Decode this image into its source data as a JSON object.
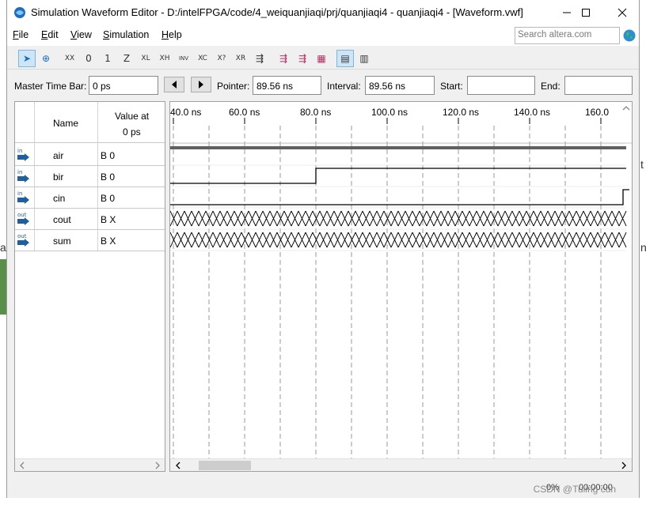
{
  "window": {
    "title": "Simulation Waveform Editor - D:/intelFPGA/code/4_weiquanjiaqi/prj/quanjiaqi4 - quanjiaqi4 - [Waveform.vwf]"
  },
  "menu": {
    "items": [
      {
        "label": "File",
        "underline": "F",
        "rest": "ile"
      },
      {
        "label": "Edit",
        "underline": "E",
        "rest": "dit"
      },
      {
        "label": "View",
        "underline": "V",
        "rest": "iew"
      },
      {
        "label": "Simulation",
        "underline": "S",
        "rest": "imulation"
      },
      {
        "label": "Help",
        "underline": "H",
        "rest": "elp"
      }
    ]
  },
  "search": {
    "placeholder": "Search altera.com"
  },
  "toolbar": {
    "icons": [
      "selection-tool-icon",
      "zoom-tool-icon",
      "undefined-value-icon",
      "force-low-icon",
      "force-high-icon",
      "high-impedance-icon",
      "weak-low-icon",
      "weak-high-icon",
      "invert-icon",
      "count-value-icon",
      "clock-icon",
      "arbitrary-value-icon",
      "random-value-icon",
      "run-functional-simulation-icon",
      "run-timing-simulation-icon",
      "generate-netlist-icon",
      "snap-to-grid-icon",
      "sort-icon"
    ],
    "glyphs": [
      "➤",
      "⊕",
      "XX",
      "0",
      "1",
      "Z",
      "XL",
      "XH",
      "INV",
      "XC",
      "X?",
      "XR",
      "⇶",
      "⇶",
      "⇶",
      "▦",
      "▤",
      "▥"
    ],
    "sub_labels": [
      "",
      "",
      "",
      "",
      "",
      "",
      "L",
      "H",
      "",
      "C",
      "?",
      "R",
      "",
      "",
      "",
      "",
      "",
      ""
    ]
  },
  "timebar": {
    "master_label": "Master Time Bar:",
    "master_value": "0 ps",
    "pointer_label": "Pointer:",
    "pointer_value": "89.56 ns",
    "interval_label": "Interval:",
    "interval_value": "89.56 ns",
    "start_label": "Start:",
    "start_value": "",
    "end_label": "End:",
    "end_value": ""
  },
  "signals": {
    "header_name": "Name",
    "header_value_line1": "Value at",
    "header_value_line2": "0 ps",
    "rows": [
      {
        "dir": "in",
        "name": "air",
        "value": "B 0",
        "wave": "low"
      },
      {
        "dir": "in",
        "name": "bir",
        "value": "B 0",
        "wave": "rise-80"
      },
      {
        "dir": "in",
        "name": "cin",
        "value": "B 0",
        "wave": "rise-end"
      },
      {
        "dir": "out",
        "name": "cout",
        "value": "B X",
        "wave": "x"
      },
      {
        "dir": "out",
        "name": "sum",
        "value": "B X",
        "wave": "x"
      }
    ]
  },
  "timeline": {
    "ticks": [
      "40.0 ns",
      "60.0 ns",
      "80.0 ns",
      "100.0 ns",
      "120.0 ns",
      "140.0 ns",
      "160.0"
    ],
    "tick_values_ns": [
      40,
      60,
      80,
      100,
      120,
      140,
      160
    ]
  },
  "status": {
    "percent": "0%",
    "time": "00:00:00",
    "watermark": "CSDN @Tuling cun"
  },
  "colors": {
    "selection": "#cde6f7",
    "signal_in": "#1f5fa0",
    "signal_out": "#1f5fa0",
    "grid": "#9a9a9a"
  }
}
